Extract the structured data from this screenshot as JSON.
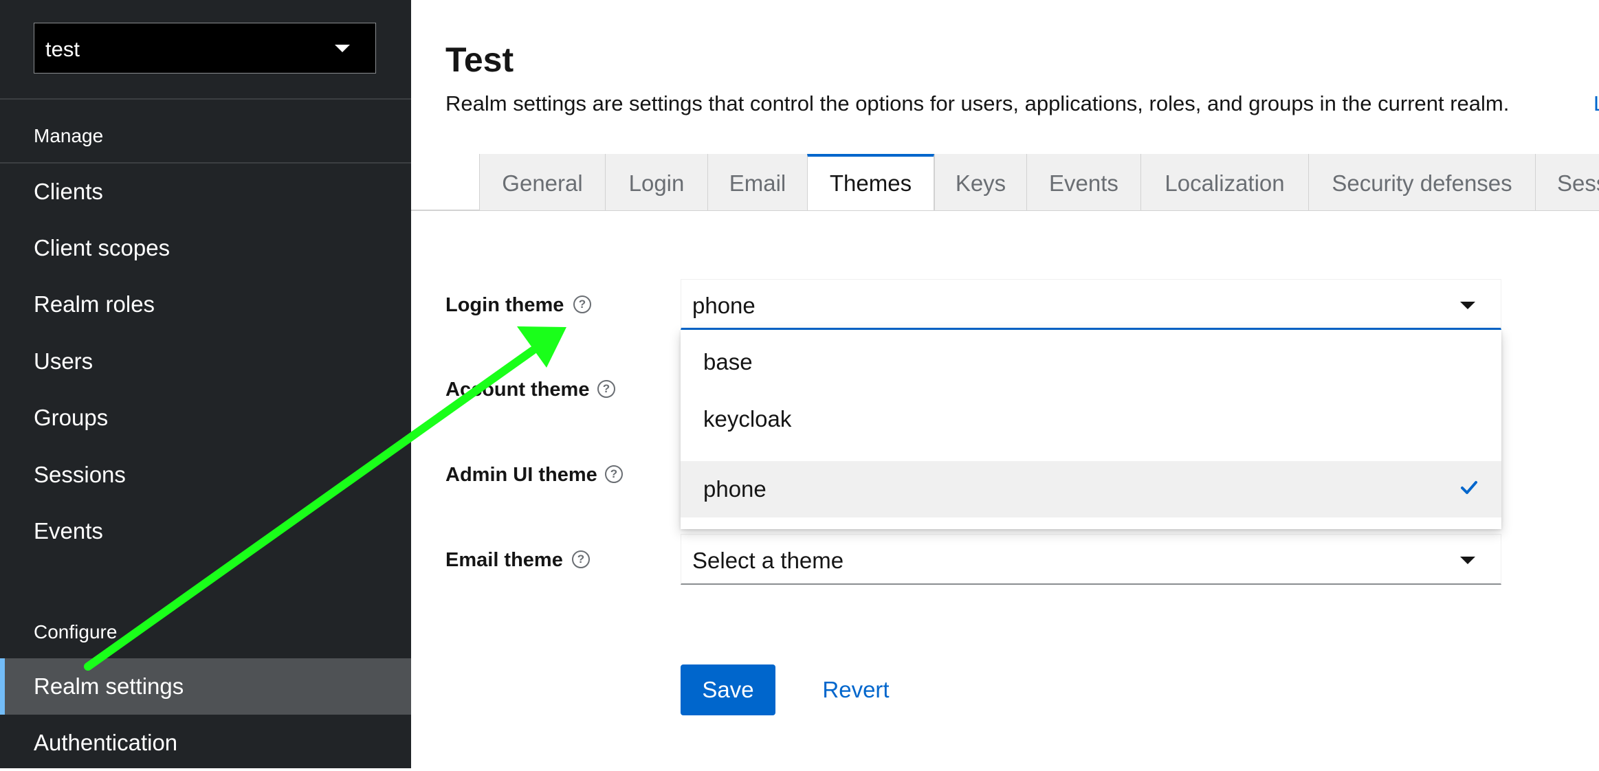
{
  "sidebar": {
    "realm_selector": {
      "value": "test"
    },
    "sections": [
      {
        "title": "Manage"
      },
      {
        "title": "Configure"
      }
    ],
    "manage_items": [
      {
        "label": "Clients"
      },
      {
        "label": "Client scopes"
      },
      {
        "label": "Realm roles"
      },
      {
        "label": "Users"
      },
      {
        "label": "Groups"
      },
      {
        "label": "Sessions"
      },
      {
        "label": "Events"
      }
    ],
    "configure_items": [
      {
        "label": "Realm settings",
        "active": true
      },
      {
        "label": "Authentication"
      }
    ]
  },
  "header": {
    "title": "Test",
    "description": "Realm settings are settings that control the options for users, applications, roles, and groups in the current realm.",
    "link_fragment": "L"
  },
  "tabs": [
    {
      "label": "General"
    },
    {
      "label": "Login"
    },
    {
      "label": "Email"
    },
    {
      "label": "Themes",
      "active": true
    },
    {
      "label": "Keys"
    },
    {
      "label": "Events"
    },
    {
      "label": "Localization"
    },
    {
      "label": "Security defenses"
    },
    {
      "label": "Sess"
    }
  ],
  "form": {
    "login_theme": {
      "label": "Login theme",
      "value": "phone"
    },
    "account_theme": {
      "label": "Account theme"
    },
    "admin_ui_theme": {
      "label": "Admin UI theme"
    },
    "email_theme": {
      "label": "Email theme",
      "placeholder": "Select a theme"
    },
    "help_glyph": "?"
  },
  "dropdown": {
    "options": [
      {
        "label": "base"
      },
      {
        "label": "keycloak"
      },
      {
        "label": "phone",
        "selected": true
      }
    ]
  },
  "actions": {
    "save_label": "Save",
    "revert_label": "Revert"
  },
  "colors": {
    "sidebar_bg": "#212427",
    "accent": "#0066cc",
    "annotation_arrow": "#1aff1a"
  },
  "icons": {
    "realm_dropdown": "caret-down-icon",
    "help": "question-circle-icon",
    "select_caret": "caret-down-icon",
    "selected_check": "check-icon"
  }
}
